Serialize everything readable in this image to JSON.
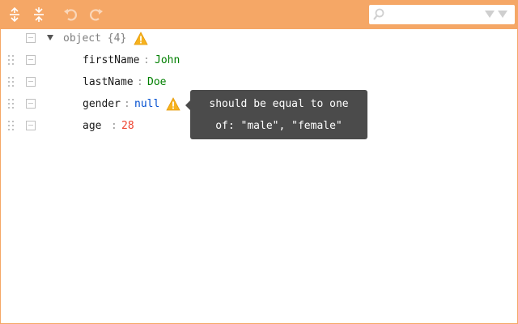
{
  "menu": {
    "expand_all": "expand-all-icon",
    "collapse_all": "collapse-all-icon",
    "undo": "undo-icon",
    "redo": "redo-icon",
    "search": {
      "value": "",
      "placeholder": ""
    }
  },
  "tree": {
    "root_label": "object {4}",
    "fields": [
      {
        "name": "firstName",
        "value": "John",
        "type": "string"
      },
      {
        "name": "lastName",
        "value": "Doe",
        "type": "string"
      },
      {
        "name": "gender",
        "value": "null",
        "type": "null"
      },
      {
        "name": "age",
        "value": "28",
        "type": "number"
      }
    ],
    "separator": ":"
  },
  "tooltip": {
    "line1": "should be equal to one",
    "line2": "of: \"male\", \"female\""
  },
  "colors": {
    "accent": "#f5a766",
    "string": "#008000",
    "number": "#ee422e",
    "null": "#004ed0",
    "warning": "#f6b21e"
  }
}
